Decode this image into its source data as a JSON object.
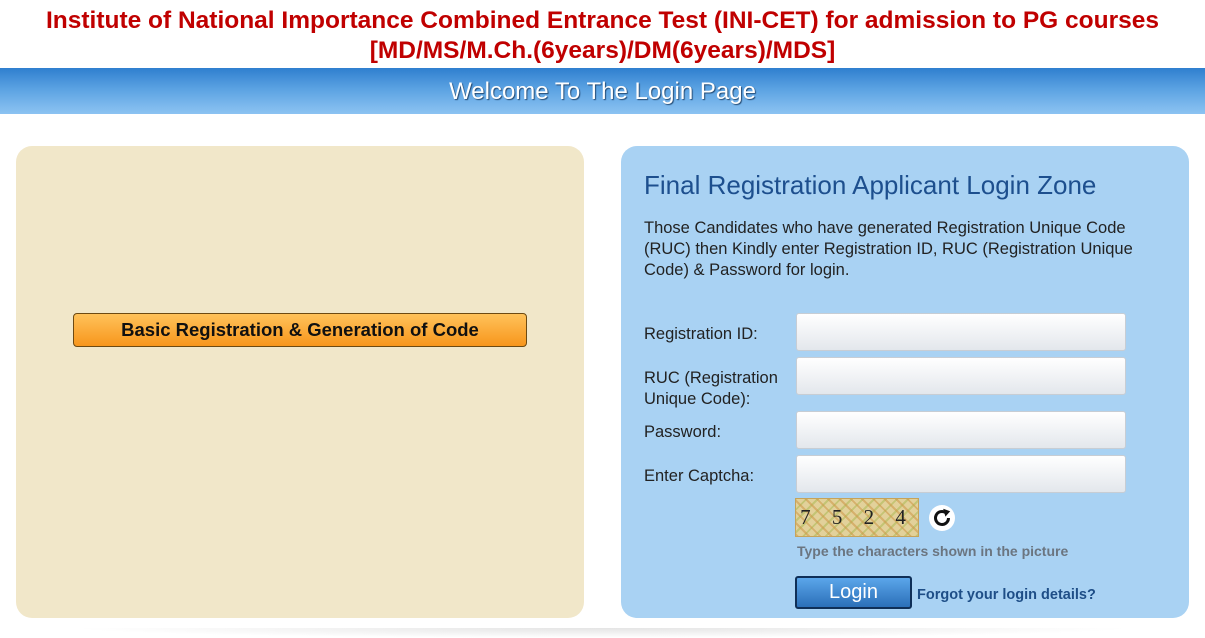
{
  "header": {
    "title_line1": "Institute of National Importance Combined Entrance Test (INI-CET) for admission to PG courses",
    "title_line2": "[MD/MS/M.Ch.(6years)/DM(6years)/MDS]",
    "welcome": "Welcome To The Login Page"
  },
  "left_panel": {
    "basic_registration_label": "Basic Registration & Generation of Code"
  },
  "login_zone": {
    "title": "Final Registration Applicant Login Zone",
    "description": "Those Candidates who have generated Registration Unique Code (RUC) then Kindly enter Registration ID, RUC (Registration Unique Code) & Password for login.",
    "fields": {
      "registration_id": {
        "label": "Registration ID:",
        "value": ""
      },
      "ruc": {
        "label_line1": "RUC (Registration",
        "label_line2": "Unique Code):",
        "value": ""
      },
      "password": {
        "label": "Password:",
        "value": ""
      },
      "captcha": {
        "label": "Enter Captcha:",
        "value": ""
      }
    },
    "captcha_text": "7 5 2 4",
    "captcha_hint": "Type the characters shown in the picture",
    "login_label": "Login",
    "forgot_label": "Forgot your login details?"
  },
  "colors": {
    "title": "#c00000",
    "banner": "#5ba2e2",
    "left_panel_bg": "#f1e7c9",
    "right_panel_bg": "#a9d2f3",
    "zone_title": "#1d4f8e",
    "register_button": "#f7961c",
    "login_button": "#2b6fb8"
  },
  "icons": {
    "refresh": "refresh-icon"
  }
}
